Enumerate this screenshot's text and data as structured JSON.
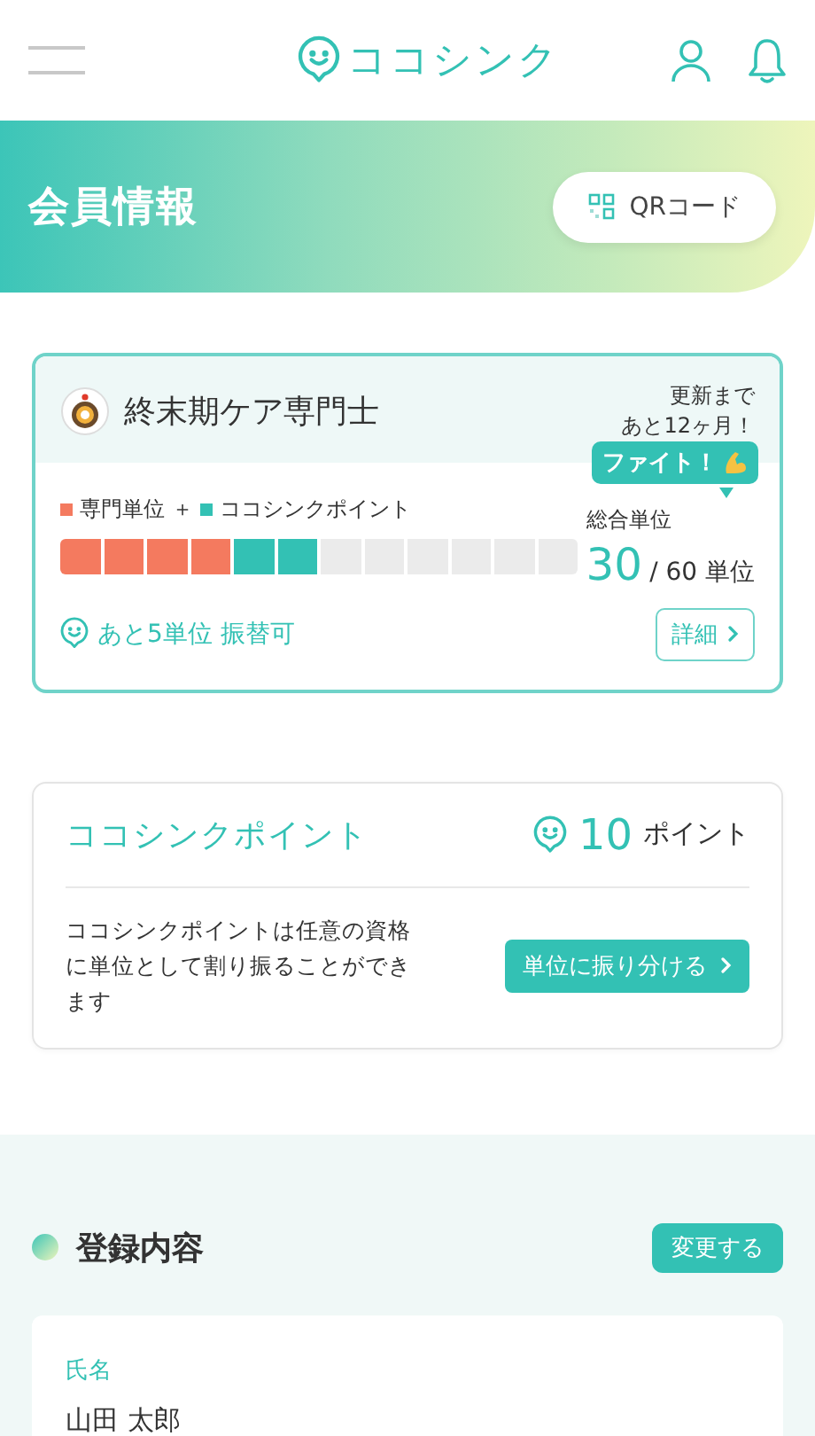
{
  "header": {
    "logo": "ココシンク"
  },
  "banner": {
    "title": "会員情報",
    "qr_button": "QRコード"
  },
  "certification": {
    "name": "終末期ケア専門士",
    "renewal": [
      "更新まで",
      "あと12ヶ月！"
    ],
    "cheer": "ファイト！",
    "legend": [
      {
        "label": "専門単位",
        "color": "#f47a5f"
      },
      {
        "label": "ココシンクポイント",
        "color": "#33c1b4"
      }
    ],
    "legend_joiner": "＋",
    "segments": [
      {
        "kind": "specialty"
      },
      {
        "kind": "specialty"
      },
      {
        "kind": "specialty"
      },
      {
        "kind": "specialty"
      },
      {
        "kind": "point"
      },
      {
        "kind": "point"
      },
      {
        "kind": "empty"
      },
      {
        "kind": "empty"
      },
      {
        "kind": "empty"
      },
      {
        "kind": "empty"
      },
      {
        "kind": "empty"
      },
      {
        "kind": "empty"
      }
    ],
    "total_label": "総合単位",
    "total_value": "30",
    "total_max": "/ 60 単位",
    "transfer_note": "あと5単位 振替可",
    "detail_button": "詳細"
  },
  "points": {
    "title": "ココシンクポイント",
    "value": "10",
    "unit": "ポイント",
    "description": "ココシンクポイントは任意の資格に単位として割り振ることができます",
    "assign_button": "単位に振り分ける"
  },
  "registration": {
    "title": "登録内容",
    "edit_button": "変更する",
    "fields": [
      {
        "label": "氏名",
        "value": "山田 太郎"
      }
    ]
  }
}
